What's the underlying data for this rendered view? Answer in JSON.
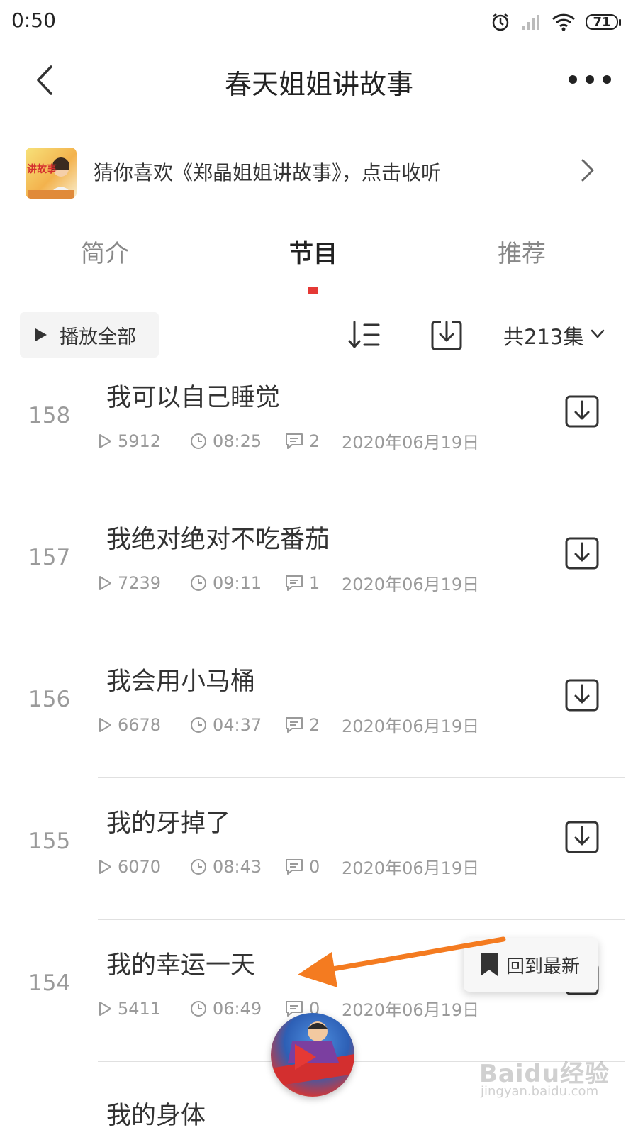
{
  "status_bar": {
    "time": "0:50",
    "battery": "71"
  },
  "header": {
    "title": "春天姐姐讲故事"
  },
  "banner": {
    "thumb_text": "讲故事",
    "text": "猜你喜欢《郑晶姐姐讲故事》，点击收听"
  },
  "tabs": [
    {
      "label": "简介",
      "active": false
    },
    {
      "label": "节目",
      "active": true
    },
    {
      "label": "推荐",
      "active": false
    }
  ],
  "toolbar": {
    "play_all": "播放全部",
    "episode_count": "共213集"
  },
  "episodes": [
    {
      "number": "158",
      "title": "我可以自己睡觉",
      "plays": "5912",
      "duration": "08:25",
      "comments": "2",
      "date": "2020年06月19日"
    },
    {
      "number": "157",
      "title": "我绝对绝对不吃番茄",
      "plays": "7239",
      "duration": "09:11",
      "comments": "1",
      "date": "2020年06月19日"
    },
    {
      "number": "156",
      "title": "我会用小马桶",
      "plays": "6678",
      "duration": "04:37",
      "comments": "2",
      "date": "2020年06月19日"
    },
    {
      "number": "155",
      "title": "我的牙掉了",
      "plays": "6070",
      "duration": "08:43",
      "comments": "0",
      "date": "2020年06月19日"
    },
    {
      "number": "154",
      "title": "我的幸运一天",
      "plays": "5411",
      "duration": "06:49",
      "comments": "0",
      "date": "2020年06月19日"
    },
    {
      "number": "",
      "title": "我的身体",
      "plays": "",
      "duration": "",
      "comments": "",
      "date": ""
    }
  ],
  "overlay": {
    "back_to_latest": "回到最新"
  },
  "watermark": {
    "logo": "Baidu经验",
    "url": "jingyan.baidu.com"
  },
  "colors": {
    "accent": "#e53935",
    "annotation_arrow": "#f47b20"
  }
}
